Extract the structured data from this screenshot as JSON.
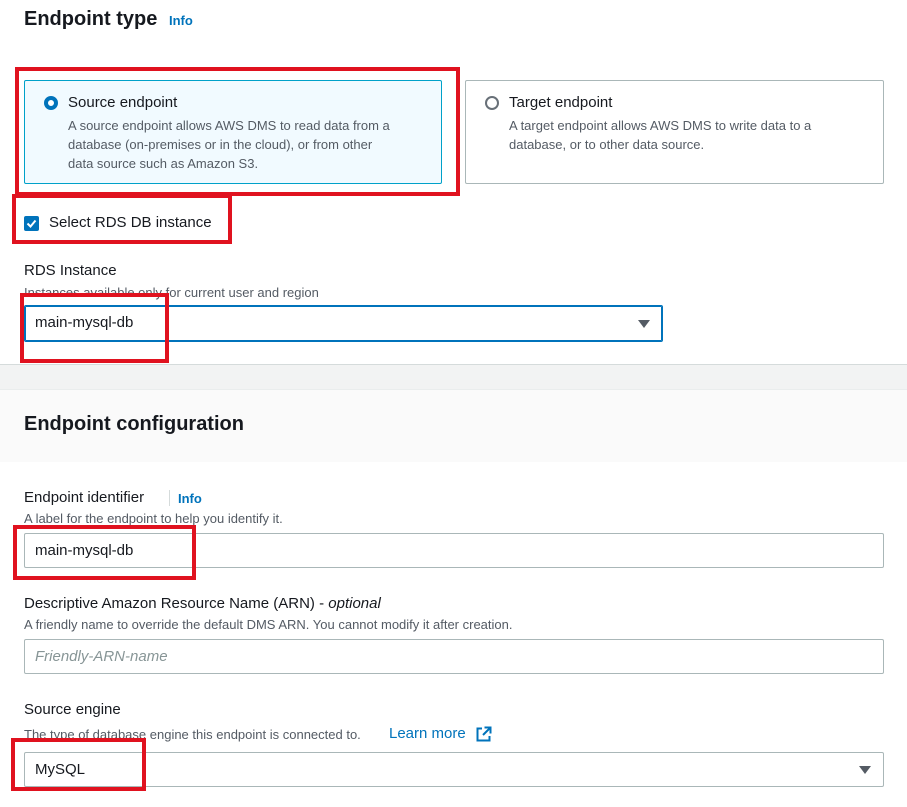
{
  "endpoint_type": {
    "title": "Endpoint type",
    "info_label": "Info",
    "options": [
      {
        "title": "Source endpoint",
        "description_lines": [
          "A source endpoint allows AWS DMS to read data from a",
          "database (on-premises or in the cloud), or from other",
          "data source such as Amazon S3."
        ],
        "selected": true
      },
      {
        "title": "Target endpoint",
        "description_lines": [
          "A target endpoint allows AWS DMS to write data to a",
          "database, or to other data source."
        ],
        "selected": false
      }
    ],
    "rds_checkbox_label": "Select RDS DB instance",
    "rds_checkbox_checked": true,
    "rds_instance_label": "RDS Instance",
    "rds_instance_description": "Instances available only for current user and region",
    "rds_instance_value": "main-mysql-db"
  },
  "endpoint_configuration": {
    "title": "Endpoint configuration",
    "identifier_label": "Endpoint identifier",
    "identifier_info": "Info",
    "identifier_description": "A label for the endpoint to help you identify it.",
    "identifier_value": "main-mysql-db",
    "arn_label": "Descriptive Amazon Resource Name (ARN) -",
    "arn_optional": "optional",
    "arn_description": "A friendly name to override the default DMS ARN. You cannot modify it after creation.",
    "arn_placeholder": "Friendly-ARN-name",
    "engine_label": "Source engine",
    "engine_description": "The type of database engine this endpoint is connected to.",
    "engine_learn_more": "Learn more",
    "engine_value": "MySQL"
  },
  "colors": {
    "accent": "#0073bb",
    "highlight_red": "#e0121f",
    "selected_tile_bg": "#f1faff"
  }
}
